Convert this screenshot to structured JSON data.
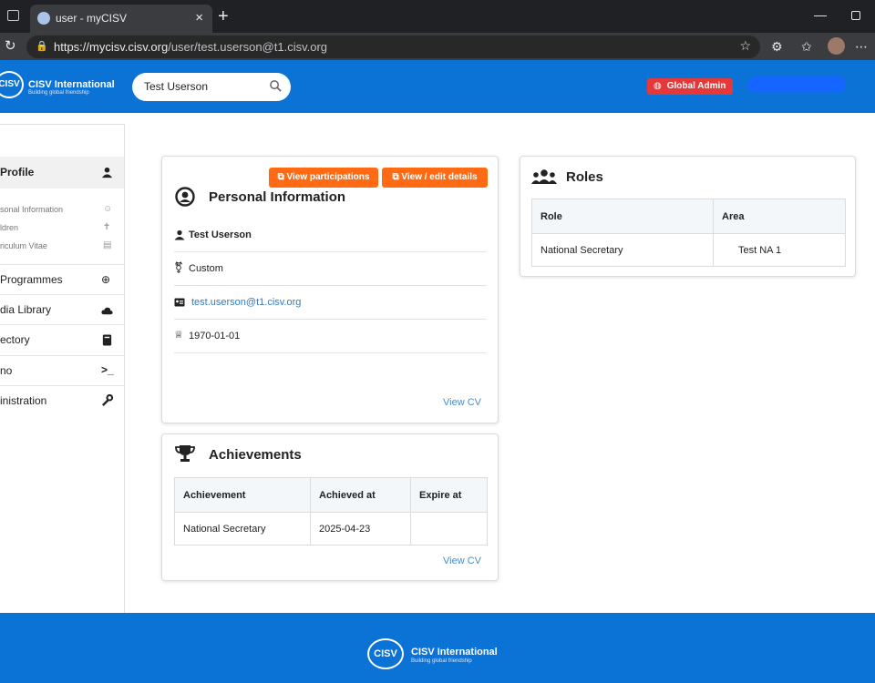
{
  "browser": {
    "tab_title": "user - myCISV",
    "tab_close": "×",
    "new_tab": "+",
    "minimize": "—",
    "url_host": "https://mycisv.cisv.org",
    "url_path": "/user/test.userson@t1.cisv.org"
  },
  "header": {
    "brand_short": "CISV",
    "brand_name": "CISV International",
    "brand_tagline": "Building global friendship",
    "search_value": "Test Userson",
    "admin_badge": "Global Admin",
    "accent_color": "#0b72d6",
    "badge_color": "#e53939"
  },
  "sidebar": {
    "profile_label": "Profile",
    "sub_items": [
      {
        "label": "sonal Information",
        "icon": "face-icon"
      },
      {
        "label": "ldren",
        "icon": "child-icon"
      },
      {
        "label": "riculum Vitae",
        "icon": "document-icon"
      }
    ],
    "items": [
      {
        "label": "Programmes",
        "icon": "globe-icon"
      },
      {
        "label": "dia Library",
        "icon": "cloud-icon"
      },
      {
        "label": "ectory",
        "icon": "book-icon"
      },
      {
        "label": "no",
        "icon": "terminal-icon"
      },
      {
        "label": "inistration",
        "icon": "wrench-icon"
      }
    ]
  },
  "personal": {
    "btn_participations": "View participations",
    "btn_edit": "View / edit details",
    "title": "Personal Information",
    "name": "Test Userson",
    "gender": "Custom",
    "email": "test.userson@t1.cisv.org",
    "birthdate": "1970-01-01",
    "view_cv": "View CV",
    "button_color": "#ff6a13"
  },
  "achievements": {
    "title": "Achievements",
    "columns": [
      "Achievement",
      "Achieved at",
      "Expire at"
    ],
    "rows": [
      [
        "National Secretary",
        "2025-04-23",
        ""
      ]
    ],
    "view_cv": "View CV"
  },
  "roles": {
    "title": "Roles",
    "columns": [
      "Role",
      "Area"
    ],
    "rows": [
      [
        "National Secretary",
        "Test NA 1"
      ]
    ]
  },
  "footer": {
    "brand_short": "CISV",
    "brand_name": "CISV International",
    "brand_tagline": "Building global friendship"
  }
}
